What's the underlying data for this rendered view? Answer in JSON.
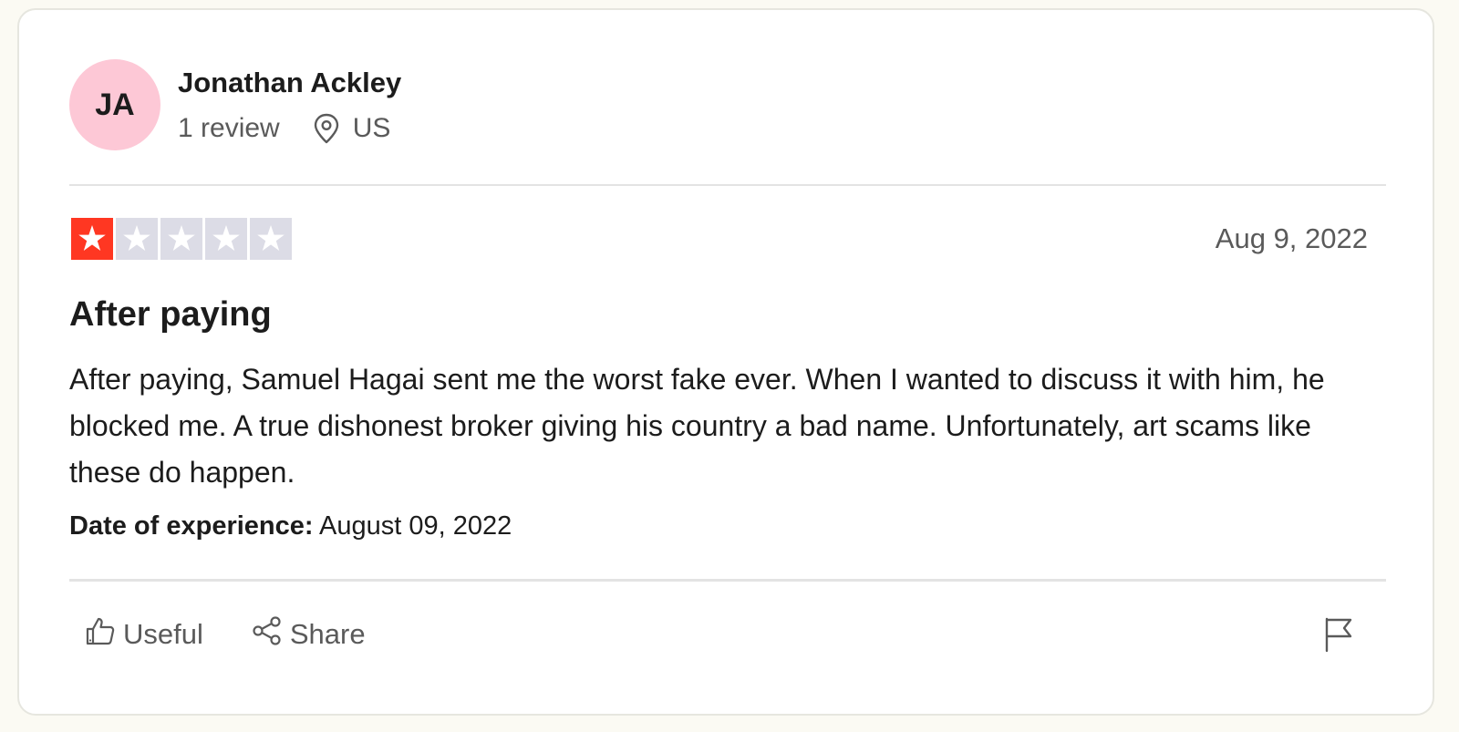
{
  "reviewer": {
    "initials": "JA",
    "name": "Jonathan Ackley",
    "review_count": "1 review",
    "location": "US",
    "avatar_color": "#fdc8d6"
  },
  "review": {
    "rating": 1,
    "max_rating": 5,
    "rating_color": "#ff3722",
    "empty_star_color": "#dcdce6",
    "date": "Aug 9, 2022",
    "title": "After paying",
    "body": "After paying, Samuel Hagai sent me the worst fake ever. When I wanted to discuss it with him, he blocked me. A true dishonest broker giving his country a bad name. Unfortunately, art scams like these do happen.",
    "experience_label": "Date of experience:",
    "experience_date": "August 09, 2022"
  },
  "actions": {
    "useful_label": "Useful",
    "share_label": "Share",
    "useful_icon": "thumbs-up-icon",
    "share_icon": "share-icon",
    "flag_icon": "flag-icon",
    "location_icon": "location-pin-icon"
  }
}
